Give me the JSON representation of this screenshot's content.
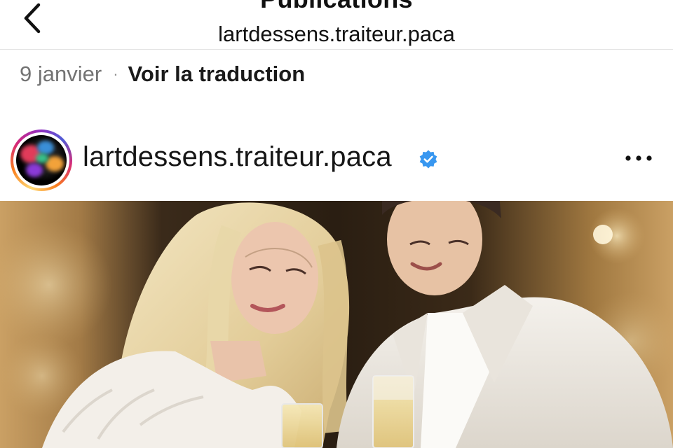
{
  "header": {
    "title": "Publications",
    "subtitle": "lartdessens.traiteur.paca",
    "back_icon": "chevron-left-icon"
  },
  "post": {
    "date": "9 janvier",
    "separator": "·",
    "translate_label": "Voir la traduction",
    "username": "lartdessens.traiteur.paca",
    "verified": true,
    "verified_color": "#3897f0",
    "more_icon": "more-horizontal-icon",
    "image_subject": "couple-wedding-photo"
  },
  "colors": {
    "text_primary": "#111111",
    "text_secondary": "#737373",
    "divider": "#e2e2e2"
  }
}
